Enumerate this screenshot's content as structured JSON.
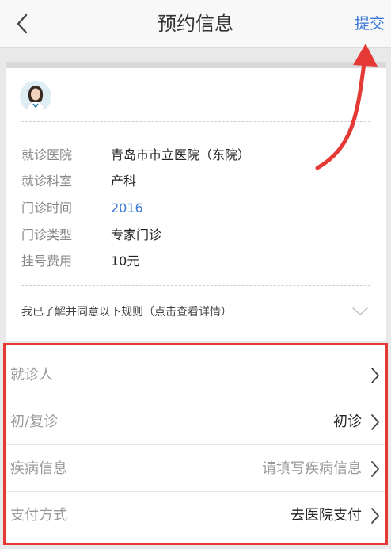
{
  "nav": {
    "title": "预约信息",
    "submit": "提交",
    "back_icon": "chevron-left-icon"
  },
  "card": {
    "avatar_icon": "doctor-avatar",
    "rows": [
      {
        "label": "就诊医院",
        "value": "青岛市市立医院（东院）"
      },
      {
        "label": "就诊科室",
        "value": "产科"
      },
      {
        "label": "门诊时间",
        "value": "2016年"
      },
      {
        "label": "门诊类型",
        "value": "专家门诊"
      },
      {
        "label": "挂号费用",
        "value": "10元"
      }
    ],
    "rules": "我已了解并同意以下规则（点击查看详情）"
  },
  "form": {
    "rows": [
      {
        "label": "就诊人",
        "value": ""
      },
      {
        "label": "初/复诊",
        "value": "初诊"
      },
      {
        "label": "疾病信息",
        "value": "请填写疾病信息"
      },
      {
        "label": "支付方式",
        "value": "去医院支付"
      }
    ]
  },
  "colors": {
    "accent": "#3a78d6",
    "highlight": "#e53935"
  }
}
